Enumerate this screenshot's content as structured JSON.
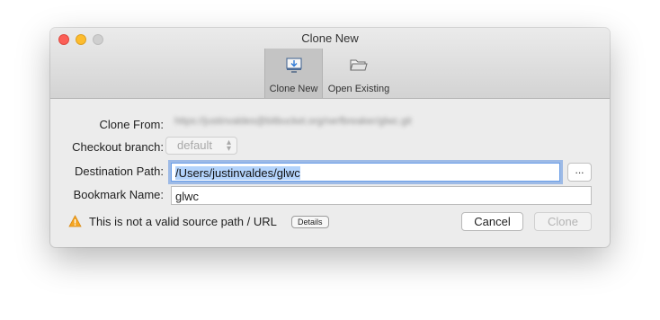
{
  "window": {
    "title": "Clone New"
  },
  "toolbar": {
    "items": [
      {
        "label": "Clone New",
        "icon": "clone-new-icon",
        "selected": true
      },
      {
        "label": "Open Existing",
        "icon": "folder-icon",
        "selected": false
      }
    ]
  },
  "form": {
    "clone_from": {
      "label": "Clone From:",
      "value": "https://justinvaldes@bitbucket.org/nerfbreaker/glwc.git"
    },
    "checkout_branch": {
      "label": "Checkout branch:",
      "value": "default"
    },
    "destination_path": {
      "label": "Destination Path:",
      "value": "/Users/justinvaldes/glwc",
      "browse_label": "..."
    },
    "bookmark_name": {
      "label": "Bookmark Name:",
      "value": "glwc"
    }
  },
  "status": {
    "message": "This is not a valid source path / URL",
    "details_label": "Details",
    "warning_color": "#f5a623"
  },
  "buttons": {
    "cancel": "Cancel",
    "clone": "Clone"
  },
  "colors": {
    "selection": "#b3d3fb",
    "focus_ring": "#5c91e1"
  }
}
